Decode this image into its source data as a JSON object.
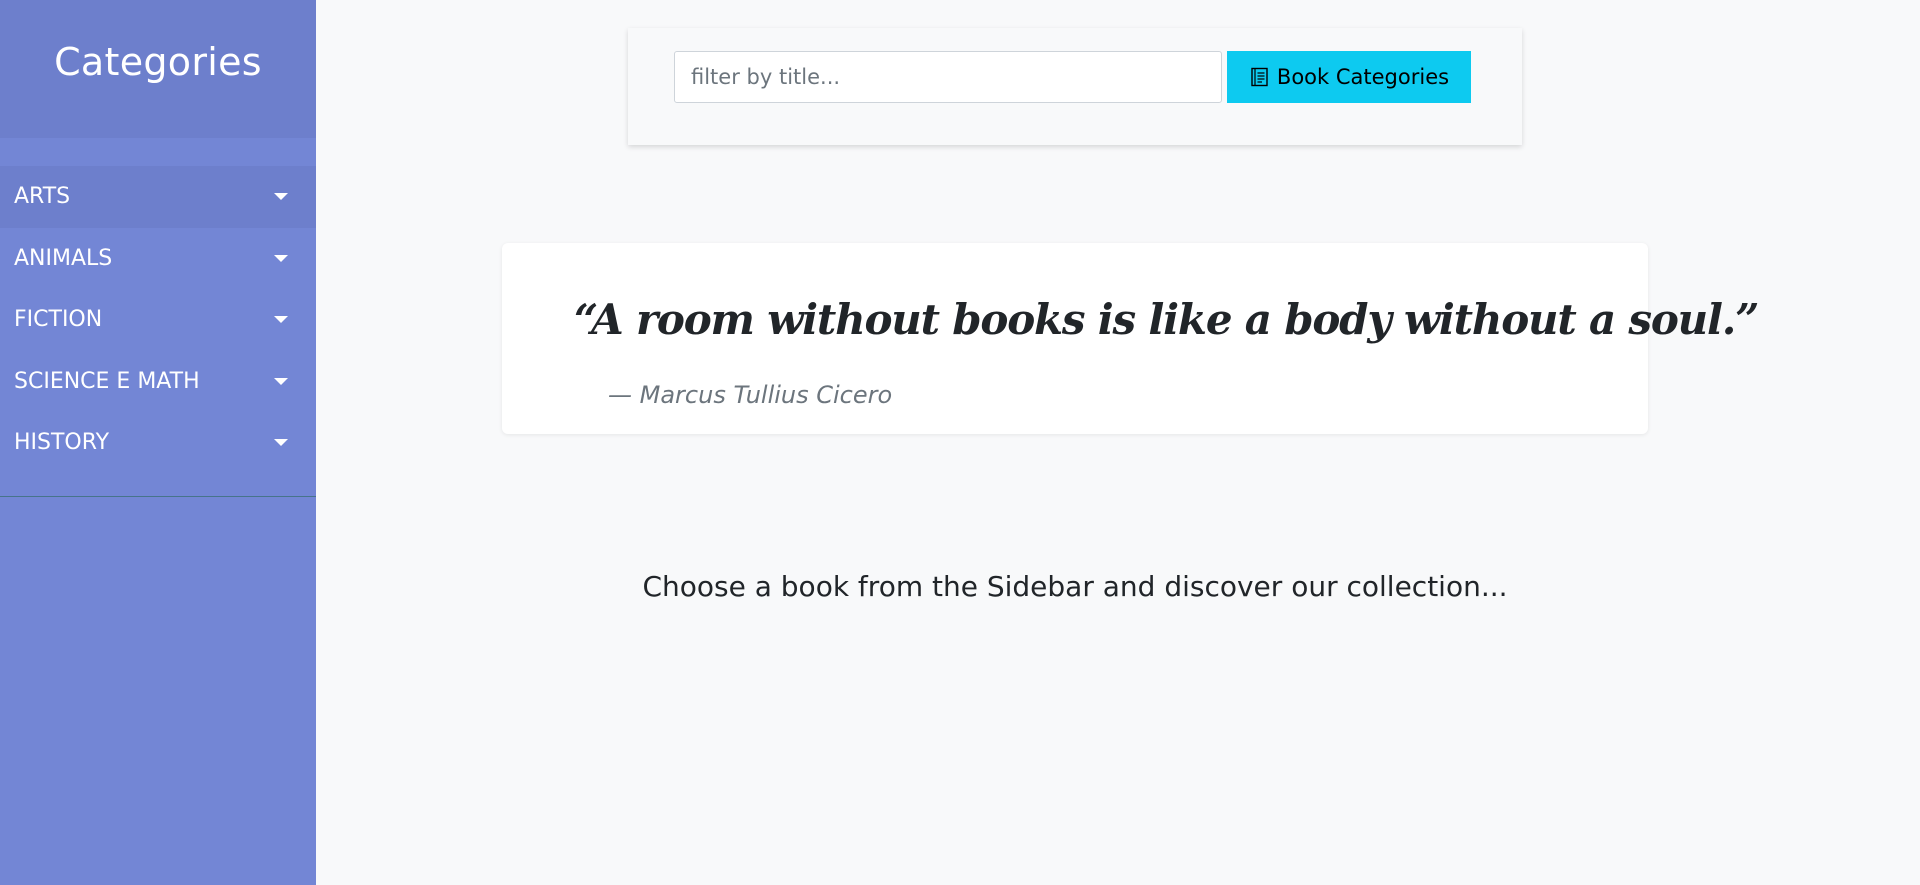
{
  "sidebar": {
    "title": "Categories",
    "items": [
      {
        "label": "ARTS"
      },
      {
        "label": "ANIMALS"
      },
      {
        "label": "FICTION"
      },
      {
        "label": "SCIENCE E MATH"
      },
      {
        "label": "HISTORY"
      }
    ]
  },
  "search": {
    "placeholder": "filter by title...",
    "value": "",
    "button_label": "Book Categories",
    "button_icon": "book-icon"
  },
  "quote": {
    "text": "“A room without books is like a body without a soul.”",
    "author": "— Marcus Tullius Cicero"
  },
  "main": {
    "prompt": "Choose a book from the Sidebar and discover our collection..."
  },
  "colors": {
    "sidebar_bg": "#7386d5",
    "sidebar_header_bg": "#6d7fcc",
    "button_bg": "#0dcaf0",
    "page_bg": "#f8f9fa"
  }
}
